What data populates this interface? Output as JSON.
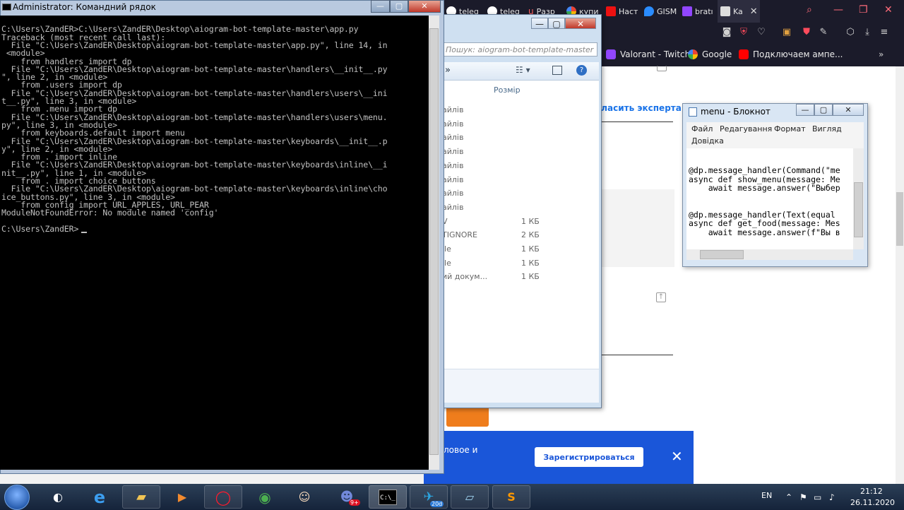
{
  "browser": {
    "tabs": [
      {
        "label": "teleg",
        "icon": "github-icon"
      },
      {
        "label": "teleg",
        "icon": "github-icon"
      },
      {
        "label": "Разр",
        "icon": "upwork-icon"
      },
      {
        "label": "купи",
        "icon": "google-icon"
      },
      {
        "label": "Наст",
        "icon": "flag-icon"
      },
      {
        "label": "GISM",
        "icon": "drop-icon"
      },
      {
        "label": "bratı",
        "icon": "twitch-icon"
      },
      {
        "label": "Ka",
        "icon": "tab-icon"
      }
    ],
    "bookmarks": [
      {
        "label": "Valorant - Twitch",
        "icon": "twitch-icon"
      },
      {
        "label": "Google",
        "icon": "google-icon"
      },
      {
        "label": "Подключаем ампе...",
        "icon": "youtube-icon"
      }
    ],
    "page": {
      "expert_link": "гласить эксперта",
      "register_text": "ловое и",
      "register_button": "Зарегистрироваться"
    }
  },
  "explorer": {
    "search_placeholder": "Пошук: aiogram-bot-template-master",
    "column_size": "Розмір",
    "rows": [
      {
        "name": "айлів",
        "size": ""
      },
      {
        "name": "айлів",
        "size": ""
      },
      {
        "name": "айлів",
        "size": ""
      },
      {
        "name": "айлів",
        "size": ""
      },
      {
        "name": "айлів",
        "size": ""
      },
      {
        "name": "айлів",
        "size": ""
      },
      {
        "name": "айлів",
        "size": ""
      },
      {
        "name": "айлів",
        "size": ""
      },
      {
        "name": "V",
        "size": "1 КБ"
      },
      {
        "name": "TIGNORE",
        "size": "2 КБ"
      },
      {
        "name": "ile",
        "size": "1 КБ"
      },
      {
        "name": "ile",
        "size": "1 КБ"
      },
      {
        "name": "ий докум...",
        "size": "1 КБ"
      }
    ]
  },
  "notepad": {
    "title": "menu - Блокнот",
    "menu": [
      "Файл",
      "Редагування",
      "Формат",
      "Вигляд",
      "Довідка"
    ],
    "lines": [
      "@dp.message_handler(Command(\"me",
      "async def show_menu(message: Me",
      "    await message.answer(\"Выбер",
      "",
      "",
      "@dp.message_handler(Text(equal",
      "async def get_food(message: Mes",
      "    await message.answer(f\"Вы в"
    ]
  },
  "cmd": {
    "title": "Administrator: Командний рядок",
    "lines": [
      "",
      "C:\\Users\\ZandER>C:\\Users\\ZandER\\Desktop\\aiogram-bot-template-master\\app.py",
      "Traceback (most recent call last):",
      "  File \"C:\\Users\\ZandER\\Desktop\\aiogram-bot-template-master\\app.py\", line 14, in",
      " <module>",
      "    from handlers import dp",
      "  File \"C:\\Users\\ZandER\\Desktop\\aiogram-bot-template-master\\handlers\\__init__.py",
      "\", line 2, in <module>",
      "    from .users import dp",
      "  File \"C:\\Users\\ZandER\\Desktop\\aiogram-bot-template-master\\handlers\\users\\__ini",
      "t__.py\", line 3, in <module>",
      "    from .menu import dp",
      "  File \"C:\\Users\\ZandER\\Desktop\\aiogram-bot-template-master\\handlers\\users\\menu.",
      "py\", line 3, in <module>",
      "    from keyboards.default import menu",
      "  File \"C:\\Users\\ZandER\\Desktop\\aiogram-bot-template-master\\keyboards\\__init__.p",
      "y\", line 2, in <module>",
      "    from . import inline",
      "  File \"C:\\Users\\ZandER\\Desktop\\aiogram-bot-template-master\\keyboards\\inline\\__i",
      "nit__.py\", line 1, in <module>",
      "    from . import choice_buttons",
      "  File \"C:\\Users\\ZandER\\Desktop\\aiogram-bot-template-master\\keyboards\\inline\\cho",
      "ice_buttons.py\", line 3, in <module>",
      "    from config import URL_APPLES, URL_PEAR",
      "ModuleNotFoundError: No module named 'config'",
      "",
      "C:\\Users\\ZandER>"
    ]
  },
  "taskbar": {
    "language": "EN",
    "time": "21:12",
    "date": "26.11.2020",
    "discord_badge": "9+",
    "telegram_badge": "20d",
    "cmd_glyph": "C:\\_"
  }
}
